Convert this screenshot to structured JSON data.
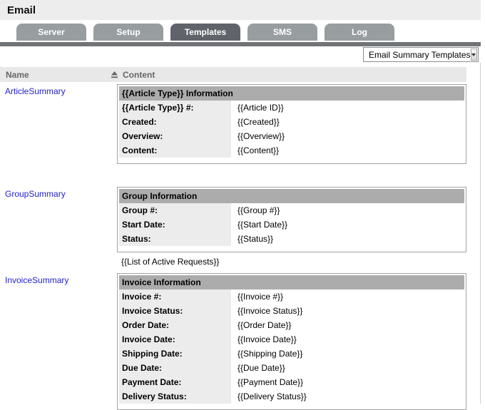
{
  "page": {
    "title": "Email"
  },
  "tabs": [
    {
      "label": "Server",
      "active": false
    },
    {
      "label": "Setup",
      "active": false
    },
    {
      "label": "Templates",
      "active": true
    },
    {
      "label": "SMS",
      "active": false
    },
    {
      "label": "Log",
      "active": false
    }
  ],
  "toolbar": {
    "template_select": {
      "value": "Email Summary Templates",
      "icon": "chevron-down-icon"
    }
  },
  "list": {
    "columns": {
      "name": "Name",
      "content": "Content"
    },
    "sort_icon": "sort-ascending-icon",
    "rows": [
      {
        "name": "ArticleSummary",
        "box": {
          "title": "{{Article Type}} Information",
          "fields": [
            {
              "label": "{{Article Type}} #:",
              "value": "{{Article ID}}"
            },
            {
              "label": "Created:",
              "value": "{{Created}}"
            },
            {
              "label": "Overview:",
              "value": "{{Overview}}"
            },
            {
              "label": "Content:",
              "value": "{{Content}}"
            }
          ]
        }
      },
      {
        "name": "GroupSummary",
        "box": {
          "title": "Group Information",
          "fields": [
            {
              "label": "Group #:",
              "value": "{{Group #}}"
            },
            {
              "label": "Start Date:",
              "value": "{{Start Date}}"
            },
            {
              "label": "Status:",
              "value": "{{Status}}"
            }
          ]
        },
        "footer": "{{List of Active Requests}}"
      },
      {
        "name": "InvoiceSummary",
        "box": {
          "title": "Invoice Information",
          "fields": [
            {
              "label": "Invoice #:",
              "value": "{{Invoice #}}"
            },
            {
              "label": "Invoice Status:",
              "value": "{{Invoice Status}}"
            },
            {
              "label": "Order Date:",
              "value": "{{Order Date}}"
            },
            {
              "label": "Invoice Date:",
              "value": "{{Invoice Date}}"
            },
            {
              "label": "Shipping Date:",
              "value": "{{Shipping Date}}"
            },
            {
              "label": "Due Date:",
              "value": "{{Due Date}}"
            },
            {
              "label": "Payment Date:",
              "value": "{{Payment Date}}"
            },
            {
              "label": "Delivery Status:",
              "value": "{{Delivery Status}}"
            }
          ]
        }
      }
    ]
  },
  "colors": {
    "tab_inactive": "#989da0",
    "tab_active": "#60646a",
    "tab_bar": "#717477",
    "box_header_bg": "#acacac",
    "box_label_bg": "#ececec",
    "list_header_bg": "#e8e8e8",
    "link": "#2222cc"
  }
}
